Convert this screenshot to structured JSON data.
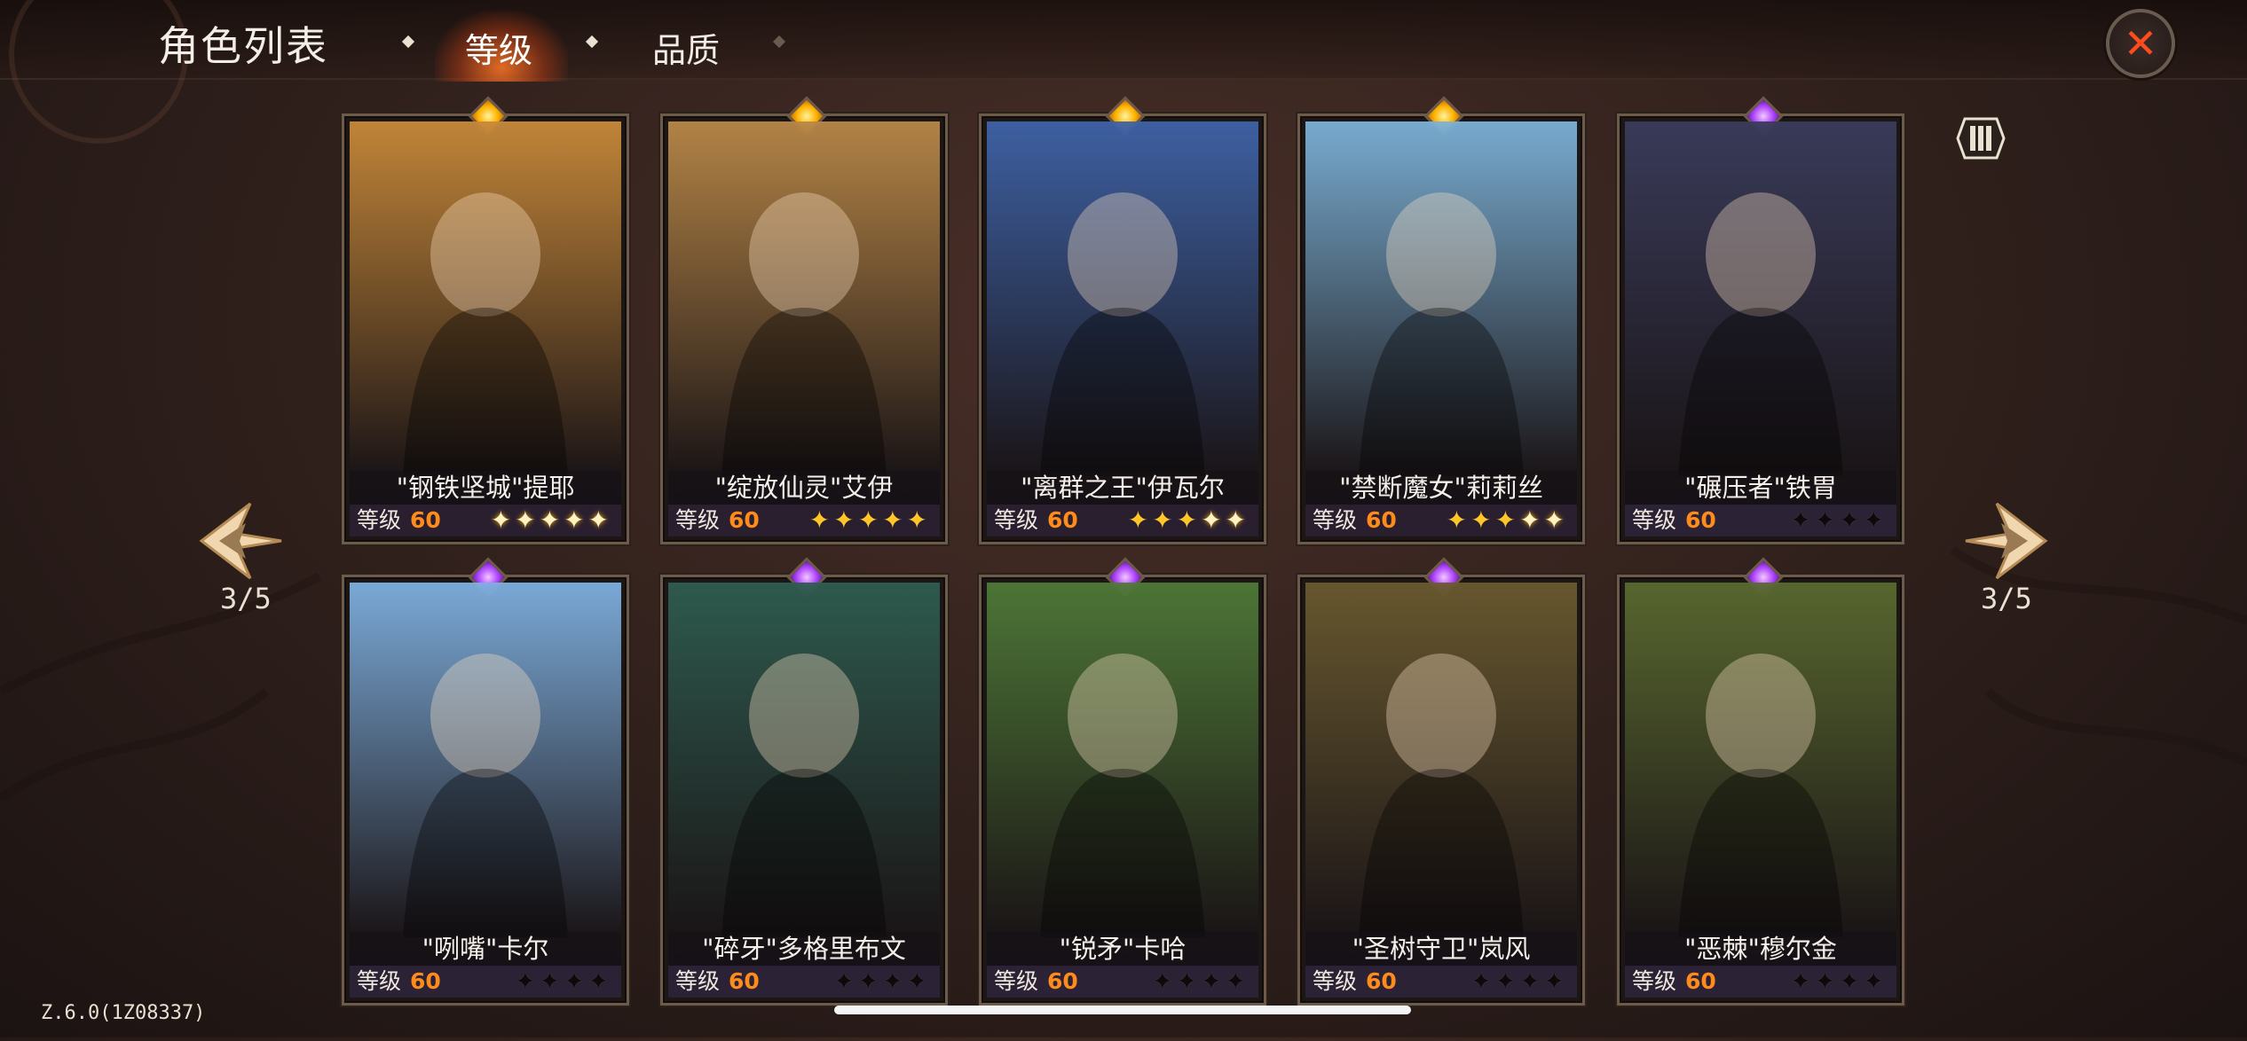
{
  "header": {
    "title": "角色列表",
    "tabs": [
      {
        "label": "等级",
        "active": true
      },
      {
        "label": "品质",
        "active": false
      }
    ],
    "close_icon": "close-icon"
  },
  "pagination": {
    "left": "3/5",
    "right": "3/5"
  },
  "level_label": "等级",
  "cards": [
    {
      "name": "\"钢铁坚城\"提耶",
      "level": "60",
      "stars": 5,
      "star_style": "white",
      "rarity": "gold",
      "art_color": "#c98a3a"
    },
    {
      "name": "\"绽放仙灵\"艾伊",
      "level": "60",
      "stars": 5,
      "star_style": "gold",
      "rarity": "gold",
      "art_color": "#b98848"
    },
    {
      "name": "\"离群之王\"伊瓦尔",
      "level": "60",
      "stars": 5,
      "star_style": "mixed",
      "rarity": "gold",
      "art_color": "#3f63a8"
    },
    {
      "name": "\"禁断魔女\"莉莉丝",
      "level": "60",
      "stars": 5,
      "star_style": "mixed",
      "rarity": "gold",
      "art_color": "#7cb2d8"
    },
    {
      "name": "\"碾压者\"铁胃",
      "level": "60",
      "stars": 4,
      "star_style": "dark",
      "rarity": "purple",
      "art_color": "#3a3c5c"
    },
    {
      "name": "\"咧嘴\"卡尔",
      "level": "60",
      "stars": 4,
      "star_style": "dark",
      "rarity": "purple",
      "art_color": "#7fb0e0"
    },
    {
      "name": "\"碎牙\"多格里布文",
      "level": "60",
      "stars": 4,
      "star_style": "dark",
      "rarity": "purple",
      "art_color": "#2f5d50"
    },
    {
      "name": "\"锐矛\"卡哈",
      "level": "60",
      "stars": 4,
      "star_style": "dark",
      "rarity": "purple",
      "art_color": "#4f7a38"
    },
    {
      "name": "\"圣树守卫\"岚风",
      "level": "60",
      "stars": 4,
      "star_style": "dark",
      "rarity": "purple",
      "art_color": "#6a5a30"
    },
    {
      "name": "\"恶棘\"穆尔金",
      "level": "60",
      "stars": 4,
      "star_style": "dark",
      "rarity": "purple",
      "art_color": "#5a6a30"
    }
  ],
  "version": "Z.6.0(1Z08337)"
}
